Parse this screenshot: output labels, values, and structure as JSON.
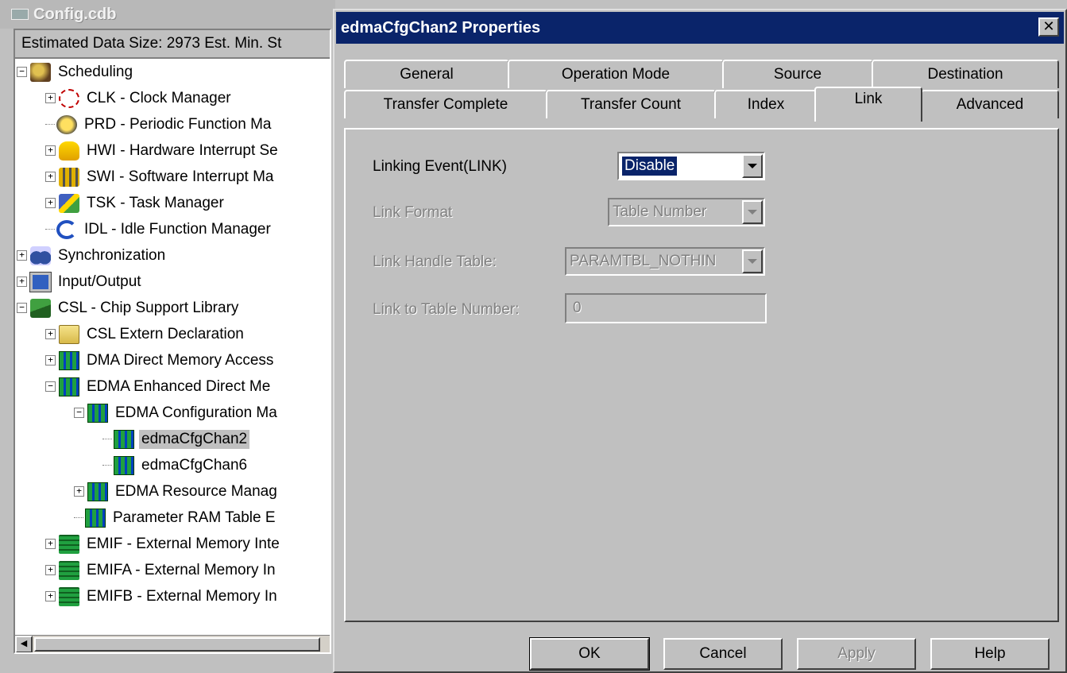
{
  "left_window": {
    "title": "Config.cdb",
    "header_text": "Estimated Data Size: 2973   Est. Min. St",
    "tree": [
      {
        "label": "Scheduling",
        "level": 0,
        "expander": "minus",
        "icon": "scheduling-icon"
      },
      {
        "label": "CLK - Clock Manager",
        "level": 1,
        "expander": "plus",
        "icon": "clock-icon"
      },
      {
        "label": "PRD - Periodic Function Ma",
        "level": 1,
        "expander": "none",
        "icon": "periodic-icon"
      },
      {
        "label": "HWI - Hardware Interrupt Se",
        "level": 1,
        "expander": "plus",
        "icon": "hand-icon"
      },
      {
        "label": "SWI - Software Interrupt Ma",
        "level": 1,
        "expander": "plus",
        "icon": "swi-icon"
      },
      {
        "label": "TSK - Task Manager",
        "level": 1,
        "expander": "plus",
        "icon": "task-icon"
      },
      {
        "label": "IDL - Idle Function Manager",
        "level": 1,
        "expander": "none",
        "icon": "idle-icon"
      },
      {
        "label": "Synchronization",
        "level": 0,
        "expander": "plus",
        "icon": "sync-icon"
      },
      {
        "label": "Input/Output",
        "level": 0,
        "expander": "plus",
        "icon": "io-icon"
      },
      {
        "label": "CSL - Chip Support Library",
        "level": 0,
        "expander": "minus",
        "icon": "csl-icon"
      },
      {
        "label": "CSL Extern Declaration",
        "level": 1,
        "expander": "plus",
        "icon": "folder-icon"
      },
      {
        "label": "DMA Direct Memory Access",
        "level": 1,
        "expander": "plus",
        "icon": "dma-icon"
      },
      {
        "label": "EDMA Enhanced Direct Me",
        "level": 1,
        "expander": "minus",
        "icon": "edma-icon"
      },
      {
        "label": "EDMA Configuration Ma",
        "level": 2,
        "expander": "minus",
        "icon": "edma-icon"
      },
      {
        "label": "edmaCfgChan2",
        "level": 3,
        "expander": "none",
        "icon": "edma-icon",
        "selected": true
      },
      {
        "label": "edmaCfgChan6",
        "level": 3,
        "expander": "none",
        "icon": "edma-icon"
      },
      {
        "label": "EDMA Resource Manag",
        "level": 2,
        "expander": "plus",
        "icon": "edma-icon"
      },
      {
        "label": "Parameter RAM Table E",
        "level": 2,
        "expander": "none",
        "icon": "edma-icon"
      },
      {
        "label": "EMIF - External Memory Inte",
        "level": 1,
        "expander": "plus",
        "icon": "chip-icon"
      },
      {
        "label": "EMIFA - External Memory In",
        "level": 1,
        "expander": "plus",
        "icon": "chip-icon"
      },
      {
        "label": "EMIFB - External Memory In",
        "level": 1,
        "expander": "plus",
        "icon": "chip-icon"
      }
    ]
  },
  "dialog": {
    "title": "edmaCfgChan2 Properties",
    "close_glyph": "✕",
    "tabs_back": [
      "General",
      "Operation Mode",
      "Source",
      "Destination"
    ],
    "tabs_front": [
      "Transfer Complete",
      "Transfer Count",
      "Index",
      "Link",
      "Advanced"
    ],
    "active_tab": "Link",
    "fields": {
      "linking_event_label": "Linking Event(LINK)",
      "linking_event_value": "Disable",
      "link_format_label": "Link Format",
      "link_format_value": "Table Number",
      "link_handle_label": "Link Handle Table:",
      "link_handle_value": "PARAMTBL_NOTHIN",
      "link_table_number_label": "Link to Table Number:",
      "link_table_number_value": "0"
    },
    "buttons": {
      "ok": "OK",
      "cancel": "Cancel",
      "apply": "Apply",
      "help": "Help"
    }
  }
}
